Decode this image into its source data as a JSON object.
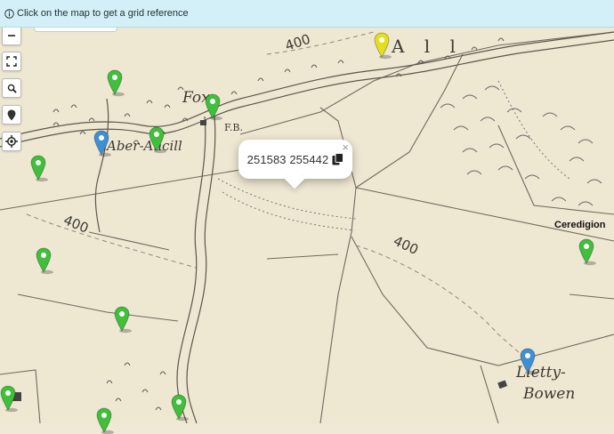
{
  "info_bar": {
    "text": "Click on the map to get a grid reference",
    "icon": "info-circle-icon"
  },
  "controls": [
    {
      "name": "zoom-out-button",
      "label": "−",
      "icon": "minus-icon"
    },
    {
      "name": "fullscreen-button",
      "icon": "fullscreen-icon"
    },
    {
      "name": "search-button",
      "icon": "search-icon"
    },
    {
      "name": "marker-button",
      "icon": "map-pin-icon"
    },
    {
      "name": "locate-button",
      "icon": "crosshair-icon"
    }
  ],
  "popup": {
    "coordinates": "251583 255442",
    "close_label": "×",
    "copy_icon": "copy-icon"
  },
  "map_labels": {
    "region": "Ceredigion",
    "place_1": "Aber-Ancill",
    "place_2": "Fox",
    "fb": "F.B.",
    "contour_1": "400",
    "contour_2": "400",
    "contour_3": "400",
    "letty_1": "Lletty-",
    "letty_2": "Bowen",
    "all": "A l l"
  },
  "markers": [
    {
      "color": "#e4df1e",
      "kind": "yellow"
    },
    {
      "color": "#3fbf3a",
      "kind": "green"
    },
    {
      "color": "#3fbf3a",
      "kind": "green"
    },
    {
      "color": "#3f8fd4",
      "kind": "blue"
    },
    {
      "color": "#3fbf3a",
      "kind": "green"
    },
    {
      "color": "#3fbf3a",
      "kind": "green"
    },
    {
      "color": "#3fbf3a",
      "kind": "green"
    },
    {
      "color": "#3fbf3a",
      "kind": "green"
    },
    {
      "color": "#3fbf3a",
      "kind": "green"
    },
    {
      "color": "#3f8fd4",
      "kind": "blue"
    },
    {
      "color": "#3fbf3a",
      "kind": "green"
    },
    {
      "color": "#3fbf3a",
      "kind": "green"
    },
    {
      "color": "#3fbf3a",
      "kind": "green"
    }
  ]
}
